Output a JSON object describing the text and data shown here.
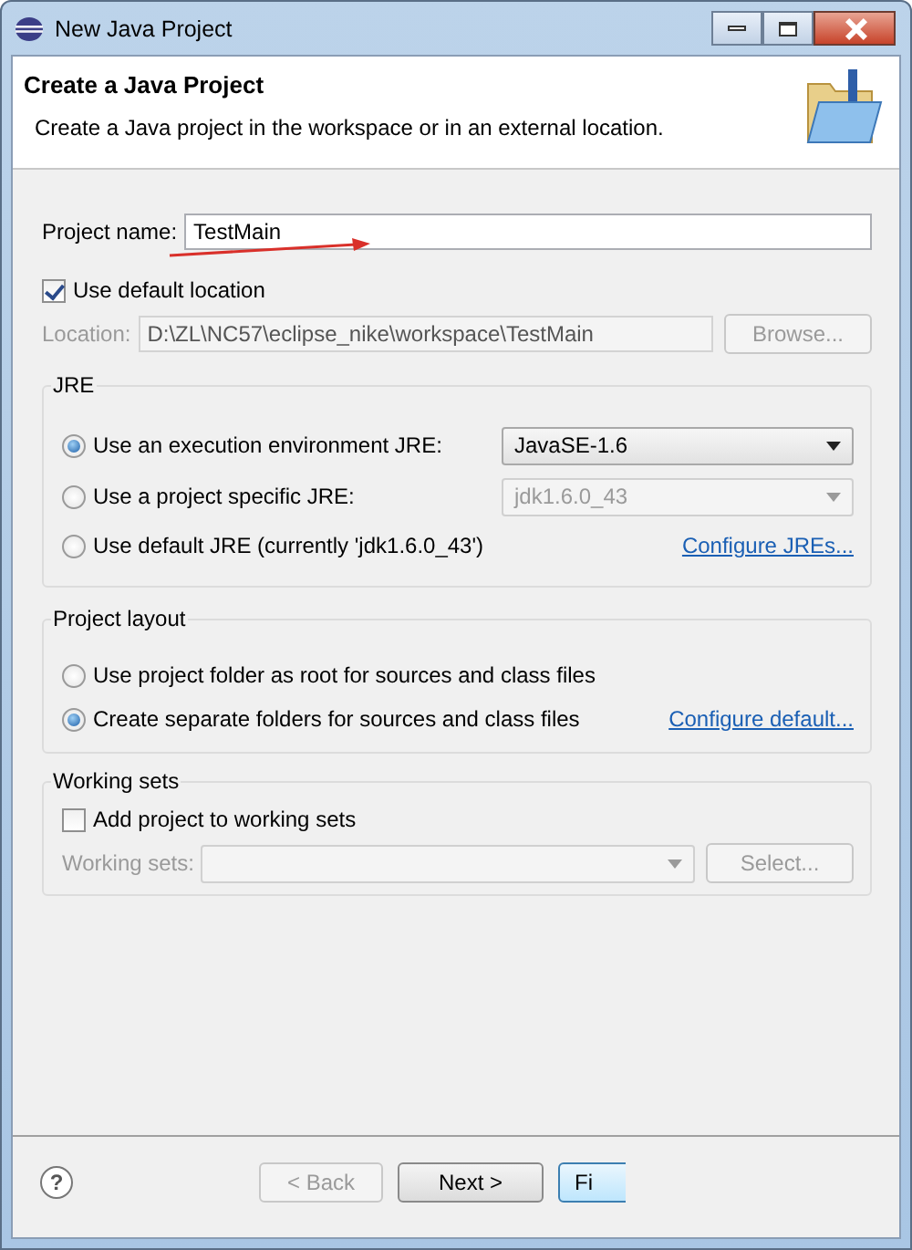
{
  "window": {
    "title": "New Java Project"
  },
  "header": {
    "title": "Create a Java Project",
    "description": "Create a Java project in the workspace or in an external location."
  },
  "project_name": {
    "label": "Project name:",
    "value": "TestMain"
  },
  "use_default_location": {
    "label": "Use default location",
    "checked": true
  },
  "location": {
    "label": "Location:",
    "value": "D:\\ZL\\NC57\\eclipse_nike\\workspace\\TestMain",
    "disabled": true,
    "button": "Browse..."
  },
  "jre": {
    "title": "JRE",
    "options": [
      {
        "label": "Use an execution environment JRE:",
        "selected": true,
        "kind": "dropdown",
        "value": "JavaSE-1.6",
        "disabled": false
      },
      {
        "label": "Use a project specific JRE:",
        "selected": false,
        "kind": "dropdown",
        "value": "jdk1.6.0_43",
        "disabled": true
      },
      {
        "label": "Use default JRE (currently 'jdk1.6.0_43')",
        "selected": false,
        "kind": "link",
        "link": "Configure JREs..."
      }
    ]
  },
  "project_layout": {
    "title": "Project layout",
    "options": [
      {
        "label": "Use project folder as root for sources and class files",
        "selected": false,
        "kind": "plain"
      },
      {
        "label": "Create separate folders for sources and class files",
        "selected": true,
        "kind": "link",
        "link": "Configure default..."
      }
    ]
  },
  "working_sets": {
    "title": "Working sets",
    "add": {
      "label": "Add project to working sets",
      "checked": false
    },
    "field": {
      "label": "Working sets:",
      "disabled": true
    },
    "button": "Select..."
  },
  "footer": {
    "help": "?",
    "buttons": [
      {
        "label": "< Back",
        "disabled": true,
        "default": false
      },
      {
        "label": "Next >",
        "disabled": false,
        "default": false
      },
      {
        "label": "Fi",
        "disabled": false,
        "default": true
      }
    ]
  }
}
